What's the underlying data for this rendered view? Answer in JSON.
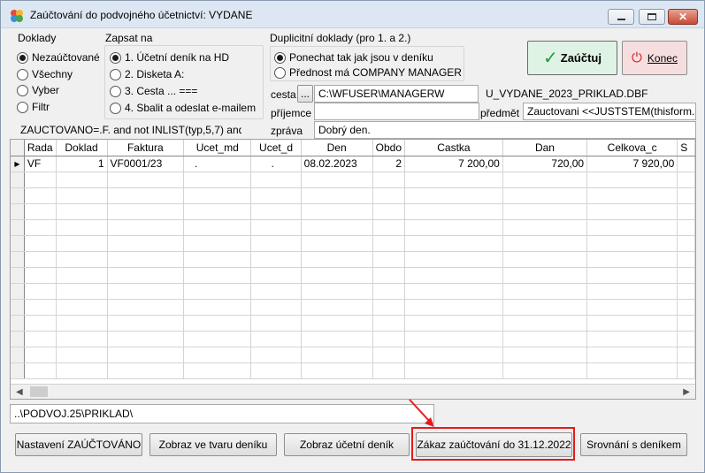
{
  "window": {
    "title": "Zaúčtování do podvojného účetnictví: VYDANE"
  },
  "doklady": {
    "header": "Doklady",
    "options": [
      "Nezaúčtované",
      "Všechny",
      "Vyber",
      "Filtr"
    ]
  },
  "zapsat": {
    "header": "Zapsat na",
    "options": [
      "1. Účetní deník na HD",
      "2. Disketa A:",
      "3. Cesta ... ===",
      "4. Sbalit a odeslat e-mailem"
    ]
  },
  "duplicitni": {
    "header": "Duplicitní doklady (pro 1. a 2.)",
    "options": [
      "Ponechat tak jak jsou v deníku",
      "Přednost má COMPANY MANAGER"
    ]
  },
  "buttons": {
    "zauctuj": "Zaúčtuj",
    "konec": "Konec",
    "browse": "..."
  },
  "fields": {
    "cesta_label": "cesta",
    "cesta_value": "C:\\WFUSER\\MANAGERW",
    "filename": "U_VYDANE_2023_PRIKLAD.DBF",
    "prijemce_label": "příjemce",
    "prijemce_value": "",
    "predmet_label": "předmět",
    "predmet_value": "Zauctovani <<JUSTSTEM(thisform.",
    "zprava_label": "zpráva",
    "zprava_value": "Dobrý den.",
    "filter_expr": "ZAUCTOVANO=.F. and  not INLIST(typ,5,7) and"
  },
  "table": {
    "columns": [
      "Rada",
      "Doklad",
      "Faktura",
      "Ucet_md",
      "Ucet_d",
      "Den",
      "Obdo",
      "Castka",
      "Dan",
      "Celkova_c",
      "S"
    ],
    "rows": [
      [
        "VF",
        "1",
        "VF0001/23",
        ".",
        ".",
        "08.02.2023",
        "2",
        "7 200,00",
        "720,00",
        "7 920,00",
        ""
      ]
    ]
  },
  "path_field": "..\\PODVOJ.25\\PRIKLAD\\",
  "bottom_buttons": {
    "nastaveni": "Nastavení ZAÚČTOVÁNO",
    "zobraz_tvar": "Zobraz ve tvaru deníku",
    "zobraz_denik": "Zobraz účetní deník",
    "zakaz": "Zákaz zaúčtování do 31.12.2022",
    "srovnani": "Srovnání s deníkem"
  },
  "colors": {
    "zauctuj_bg": "#dff3e4",
    "konec_bg": "#f6dede",
    "highlight": "#e8191a"
  }
}
